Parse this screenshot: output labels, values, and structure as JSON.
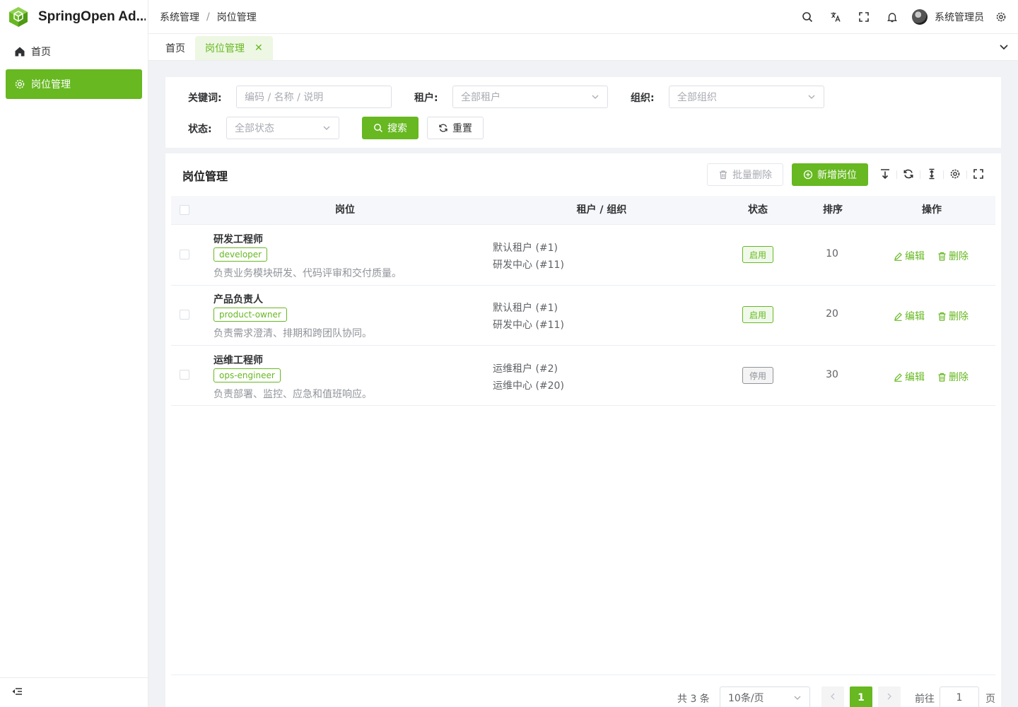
{
  "app": {
    "title": "SpringOpen Ad..."
  },
  "colors": {
    "primary": "#67b821",
    "disabled": "#909399"
  },
  "sidebar": {
    "items": [
      {
        "label": "首页",
        "icon": "home-icon"
      },
      {
        "label": "岗位管理",
        "icon": "gear-icon",
        "active": true
      }
    ],
    "collapse_icon": "collapse-menu-icon"
  },
  "header": {
    "breadcrumb": [
      "系统管理",
      "/",
      "岗位管理"
    ],
    "icons": [
      "search-icon",
      "translate-icon",
      "fullscreen-icon",
      "bell-icon",
      "settings-icon"
    ],
    "user_name": "系统管理员"
  },
  "tabs": [
    {
      "label": "首页"
    },
    {
      "label": "岗位管理",
      "active": true,
      "close": "✕"
    }
  ],
  "search": {
    "keyword_label": "关键词:",
    "keyword_placeholder": "编码 / 名称 / 说明",
    "tenant_label": "租户:",
    "tenant_placeholder": "全部租户",
    "org_label": "组织:",
    "org_placeholder": "全部组织",
    "status_label": "状态:",
    "status_placeholder": "全部状态",
    "search_button": "搜索",
    "reset_button": "重置"
  },
  "table": {
    "title": "岗位管理",
    "batch_delete": "批量删除",
    "add_button": "新增岗位",
    "toolbar_icons": [
      "export-icon",
      "refresh-icon",
      "density-icon",
      "column-settings-icon",
      "fullscreen-icon"
    ],
    "headers": {
      "post": "岗位",
      "tenant_org": "租户 / 组织",
      "status": "状态",
      "sort": "排序",
      "actions": "操作"
    },
    "rows": [
      {
        "name": "研发工程师",
        "code": "developer",
        "desc": "负责业务模块研发、代码评审和交付质量。",
        "tenant": "默认租户 (#1)",
        "org": "研发中心 (#11)",
        "status": "启用",
        "enabled": true,
        "sort": "10",
        "edit": "编辑",
        "delete": "删除"
      },
      {
        "name": "产品负责人",
        "code": "product-owner",
        "desc": "负责需求澄清、排期和跨团队协同。",
        "tenant": "默认租户 (#1)",
        "org": "研发中心 (#11)",
        "status": "启用",
        "enabled": true,
        "sort": "20",
        "edit": "编辑",
        "delete": "删除"
      },
      {
        "name": "运维工程师",
        "code": "ops-engineer",
        "desc": "负责部署、监控、应急和值班响应。",
        "tenant": "运维租户 (#2)",
        "org": "运维中心 (#20)",
        "status": "停用",
        "enabled": false,
        "sort": "30",
        "edit": "编辑",
        "delete": "删除"
      }
    ]
  },
  "pagination": {
    "total": "共 3 条",
    "page_size": "10条/页",
    "current_page": "1",
    "goto_label": "前往",
    "goto_value": "1",
    "page_suffix": "页"
  }
}
